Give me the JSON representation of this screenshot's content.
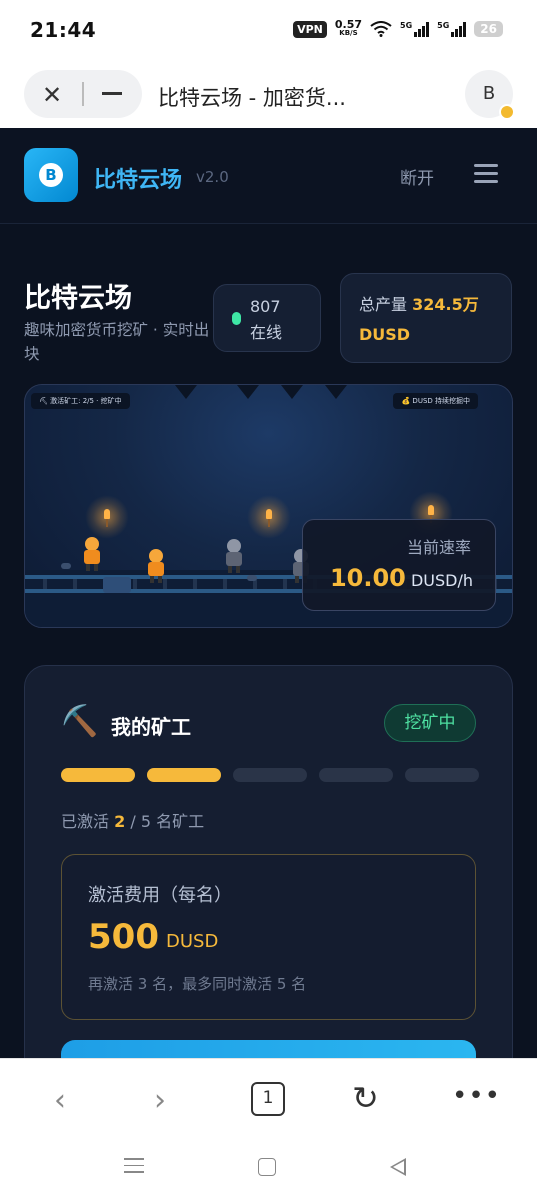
{
  "status_bar": {
    "time": "21:44",
    "vpn": "VPN",
    "speed_value": "0.57",
    "speed_unit": "KB/S",
    "signal1": "5G",
    "signal2": "5G",
    "battery": "26"
  },
  "browser": {
    "page_title": "比特云场 - 加密货...",
    "account_initial": "B",
    "tab_count": "1"
  },
  "header": {
    "logo_glyph": "B",
    "brand": "比特云场",
    "version": "v2.0",
    "disconnect": "断开"
  },
  "hero": {
    "title": "比特云场",
    "subtitle": "趣味加密货币挖矿 · 实时出块",
    "online_count": "807",
    "online_label": "在线",
    "production_label": "总产量",
    "production_value": "324.5万",
    "production_unit": "DUSD"
  },
  "scene": {
    "left_tag": "⛏ 激活矿工: 2/5 · 挖矿中",
    "right_tag": "💰 DUSD 持续挖掘中",
    "rate_label": "当前速率",
    "rate_value": "10.00",
    "rate_unit": "DUSD/h"
  },
  "miners": {
    "icon": "⛏️",
    "title": "我的矿工",
    "status": "挖矿中",
    "active": 2,
    "total": 5,
    "count_prefix": "已激活",
    "count_active": "2",
    "count_suffix": "/ 5 名矿工",
    "fee_label": "激活费用（每名）",
    "fee_amount": "500",
    "fee_unit": "DUSD",
    "fee_note": "再激活 3 名，最多同时激活 5 名"
  },
  "colors": {
    "accent_blue": "#3fb6f5",
    "gold": "#f6b93b",
    "green": "#4ee0a1",
    "bg": "#0b1220"
  }
}
